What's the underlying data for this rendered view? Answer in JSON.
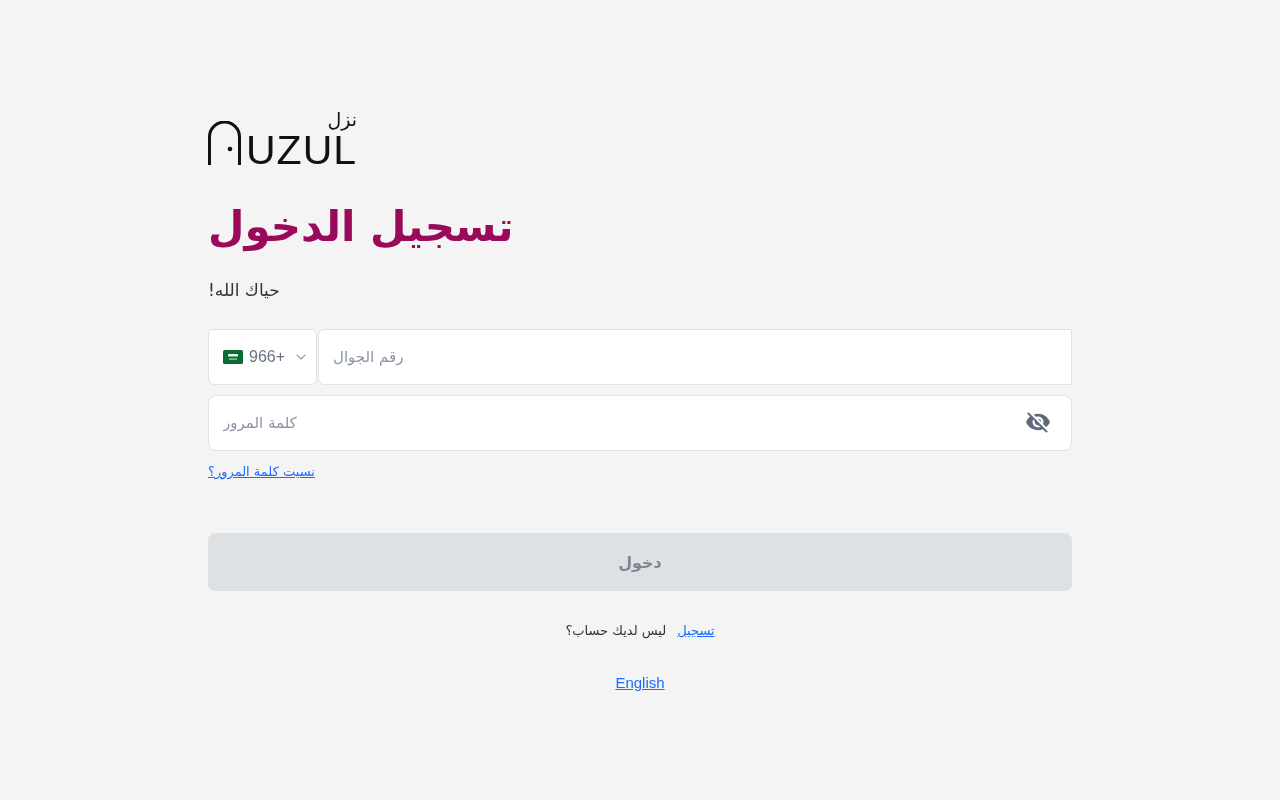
{
  "logo": {
    "wordmark": "UZUL",
    "arabic_text": "نزل"
  },
  "heading": "تسجيل الدخول",
  "subtitle": "حياك الله!",
  "phone": {
    "country_code": "+966",
    "placeholder": "رقم الجوال"
  },
  "password": {
    "placeholder": "كلمة المرور",
    "visible": false
  },
  "forgot_link": "نسيت كلمة المرور؟",
  "login_button": {
    "label": "دخول",
    "disabled": true
  },
  "signup": {
    "prompt": "ليس لديك حساب؟",
    "link": "تسجيل"
  },
  "language_link": "English"
}
